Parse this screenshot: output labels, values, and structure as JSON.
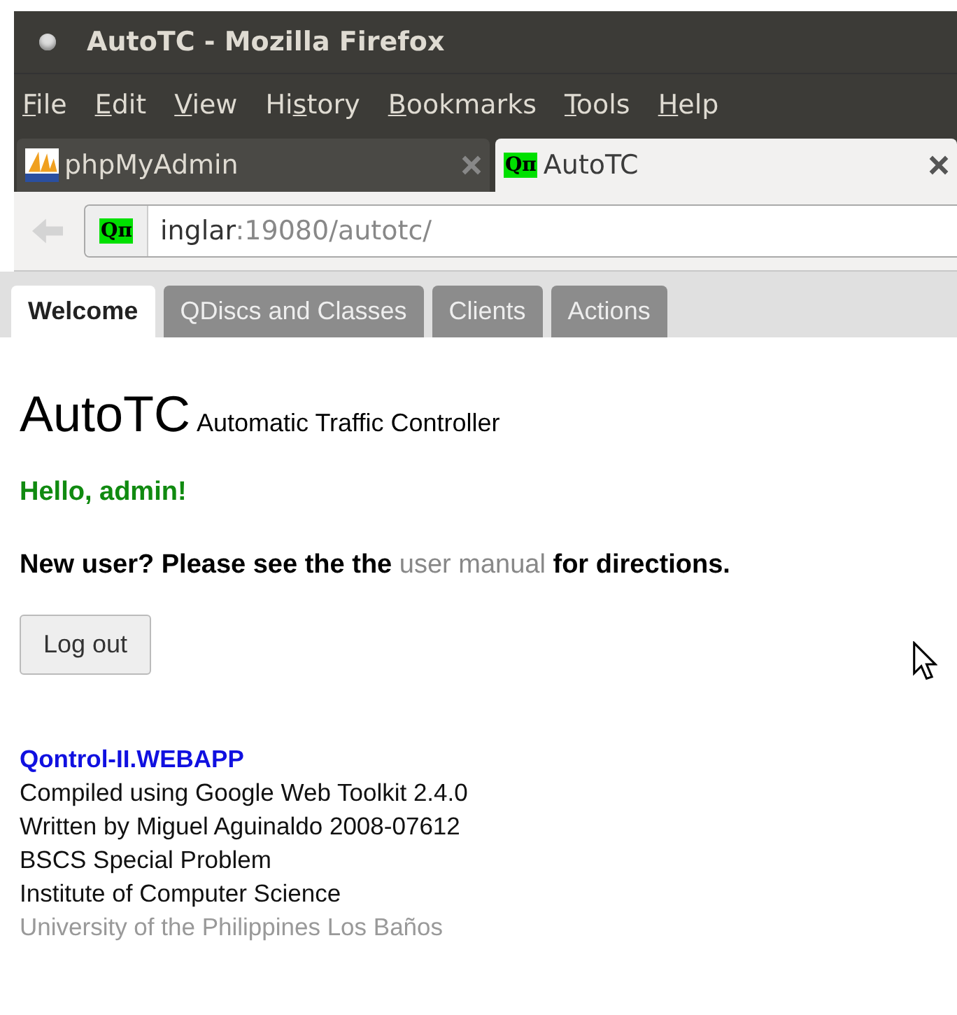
{
  "window": {
    "title": "AutoTC - Mozilla Firefox"
  },
  "menu": [
    {
      "key": "F",
      "after": "ile"
    },
    {
      "key": "E",
      "after": "dit"
    },
    {
      "key": "V",
      "after": "iew"
    },
    {
      "before": "Hi",
      "key": "s",
      "after": "tory"
    },
    {
      "key": "B",
      "after": "ookmarks"
    },
    {
      "key": "T",
      "after": "ools"
    },
    {
      "key": "H",
      "after": "elp"
    }
  ],
  "browser_tabs": [
    {
      "title": "phpMyAdmin",
      "selected": false
    },
    {
      "title": "AutoTC",
      "favicon_text": "Qπ",
      "selected": true
    }
  ],
  "address_bar": {
    "favicon_text": "Qπ",
    "host": "inglar",
    "rest": ":19080/autotc/"
  },
  "page_tabs": [
    {
      "label": "Welcome",
      "selected": true
    },
    {
      "label": "QDiscs and Classes",
      "selected": false
    },
    {
      "label": "Clients",
      "selected": false
    },
    {
      "label": "Actions",
      "selected": false
    }
  ],
  "heading": {
    "title": "AutoTC",
    "subtitle": "Automatic Traffic Controller"
  },
  "greeting": "Hello, admin!",
  "notice": {
    "before": "New user? Please see the the",
    "link": "user manual",
    "after": "for directions."
  },
  "logout_button": "Log out",
  "footer": {
    "app_name": "Qontrol-II.WEBAPP",
    "lines": [
      "Compiled using Google Web Toolkit 2.4.0",
      "Written by Miguel Aguinaldo 2008-07612",
      "BSCS Special Problem",
      "Institute of Computer Science"
    ],
    "university": "University of the Philippines Los Baños"
  }
}
